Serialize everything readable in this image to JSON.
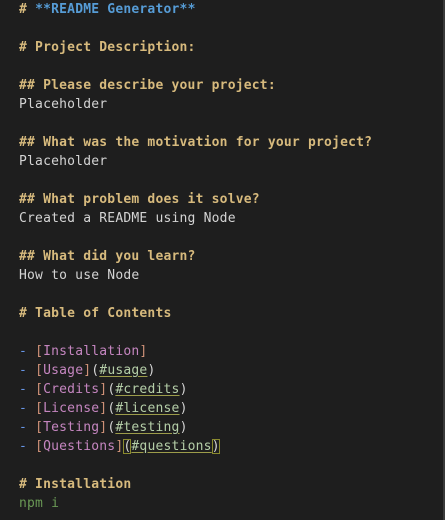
{
  "doc": {
    "title_prefix": "# ",
    "title": "**README Generator**",
    "project_description": "# Project Description:",
    "q_describe": "## Please describe your project:",
    "a_describe": "Placeholder",
    "q_motivation": "## What was the motivation for your project?",
    "a_motivation": "Placeholder",
    "q_problem": "## What problem does it solve?",
    "a_problem": "Created a README using Node",
    "q_learn": "## What did you learn?",
    "a_learn": "How to use Node",
    "toc_heading": "# Table of Contents",
    "toc": [
      {
        "dash": "- ",
        "text": "Installation",
        "url": ""
      },
      {
        "dash": "- ",
        "text": "Usage",
        "url": "#usage"
      },
      {
        "dash": "- ",
        "text": "Credits",
        "url": "#credits"
      },
      {
        "dash": "- ",
        "text": "License",
        "url": "#license"
      },
      {
        "dash": "- ",
        "text": "Testing",
        "url": "#testing"
      },
      {
        "dash": "- ",
        "text": "Questions",
        "url": "#questions"
      }
    ],
    "installation_heading": "# Installation",
    "installation_cmd": "npm i"
  },
  "colors": {
    "background": "#1e1e1e",
    "heading": "#d7ba7d",
    "title": "#569cd6",
    "body_text": "#d4d4d4",
    "link_text": "#c586c0",
    "link_url": "#b5cea8",
    "command": "#6a9955"
  }
}
